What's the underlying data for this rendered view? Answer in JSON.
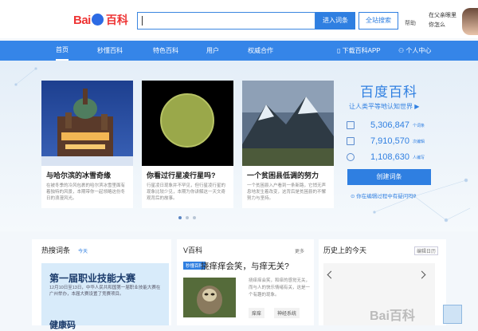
{
  "header": {
    "logo_text": "Bai百科",
    "search_placeholder": "",
    "enter_button": "进入词条",
    "all_search_button": "全站搜索",
    "help_link": "帮助",
    "tip_line1": "在父亲眼里",
    "tip_line2": "你怎么"
  },
  "nav": {
    "items": [
      "首页",
      "秒懂百科",
      "特色百科",
      "用户",
      "权威合作"
    ],
    "download_app": "下载百科APP",
    "user_center": "个人中心"
  },
  "cards": [
    {
      "title": "与哈尔滨的冰雪奇缘",
      "desc": "在被冬季的冷风包裹的哈尔滨冰雪里面有着独特的风景，本期带你一起领略这份冬日的浪漫风光。"
    },
    {
      "title": "你看过行星凌行星吗?",
      "desc": "行星凌日现象并不罕见，但行星凌行星的现象比较少见，本期为你讲解这一天文奇观背后的故事。"
    },
    {
      "title": "一个贫困县低调的努力",
      "desc": "一个贫困县入户看到一条新路，它悄无声息地发生着改变，这背后是贫困县的不懈努力与坚持。"
    }
  ],
  "baike": {
    "title": "百度百科",
    "slogan": "让人类平等地认知世界",
    "stats": [
      {
        "value": "5,306,847",
        "unit": "个词条"
      },
      {
        "value": "7,910,570",
        "unit": "次编辑"
      },
      {
        "value": "1,108,630",
        "unit": "人编写"
      }
    ],
    "create_button": "创建词条",
    "guide_link": "你在编辑过程中有疑问吗?"
  },
  "sections": {
    "hot_title": "热搜词条",
    "hot_tab": "今天",
    "vbaike_title": "V百科",
    "vbaike_more": "更多",
    "history_title": "历史上的今天",
    "history_date": "编辑日历"
  },
  "hot": {
    "item1_title": "第一届职业技能大赛",
    "item1_desc": "12月10日至13日，中华人民共和国第一届职业技能大赛在广州举办，本届大赛设置了竞赛项目。",
    "item2_title": "健康码"
  },
  "vbaike": {
    "tag": "秒懂百科",
    "title": "挠痒痒会笑，与痒无关?",
    "desc": "挠痒痒会笑，和痒的感觉无关，而与人的快乐情绪有关，这是一个有趣的现象。",
    "tags": [
      "痒痒",
      "神经系统"
    ]
  },
  "watermark": "Bai百科"
}
